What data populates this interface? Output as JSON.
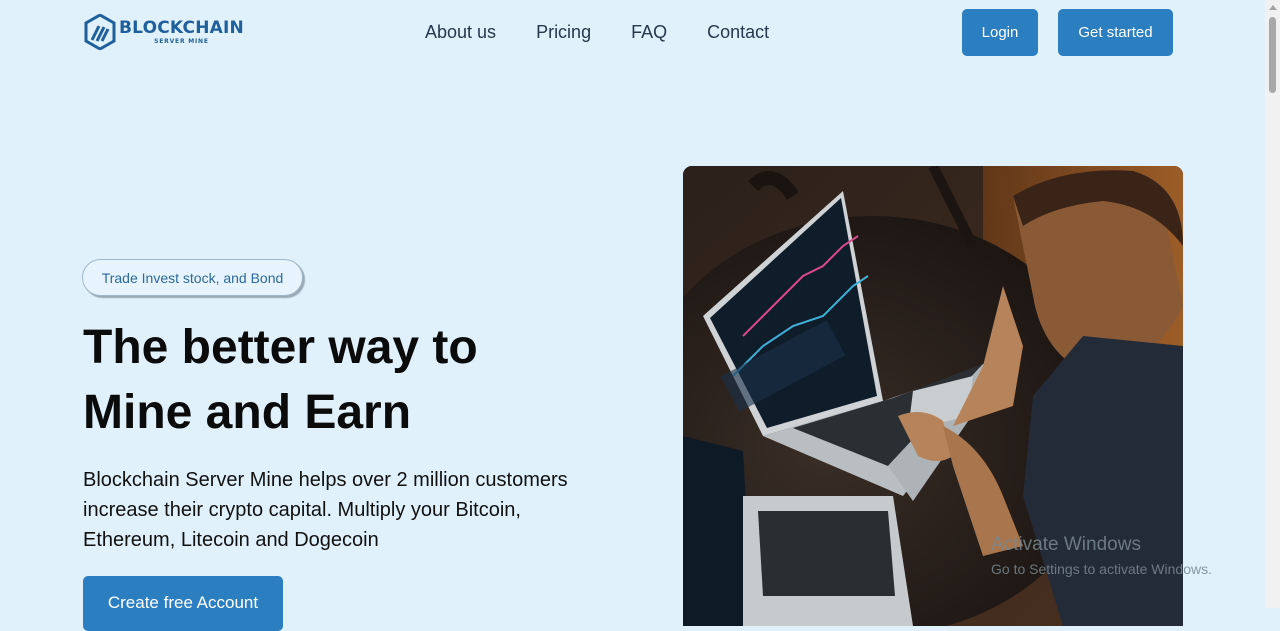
{
  "header": {
    "logo": {
      "name": "BLOCKCHAIN",
      "sub": "SERVER MINE"
    },
    "nav": [
      {
        "label": "About us"
      },
      {
        "label": "Pricing"
      },
      {
        "label": "FAQ"
      },
      {
        "label": "Contact"
      }
    ],
    "login_label": "Login",
    "get_started_label": "Get started"
  },
  "hero": {
    "tag": "Trade Invest stock, and Bond",
    "title_line1": "The better way to",
    "title_line2": "Mine and Earn",
    "description": "Blockchain Server Mine helps over 2 million customers increase their crypto capital. Multiply your Bitcoin, Ethereum, Litecoin and Dogecoin",
    "cta_label": "Create free Account",
    "image_icon": "person-with-laptop-trading-chart-image"
  },
  "watermark": {
    "title": "Activate Windows",
    "subtitle": "Go to Settings to activate Windows."
  },
  "colors": {
    "background": "#e0f1fc",
    "accent": "#2b7ec0",
    "logo": "#1f5f9c"
  }
}
